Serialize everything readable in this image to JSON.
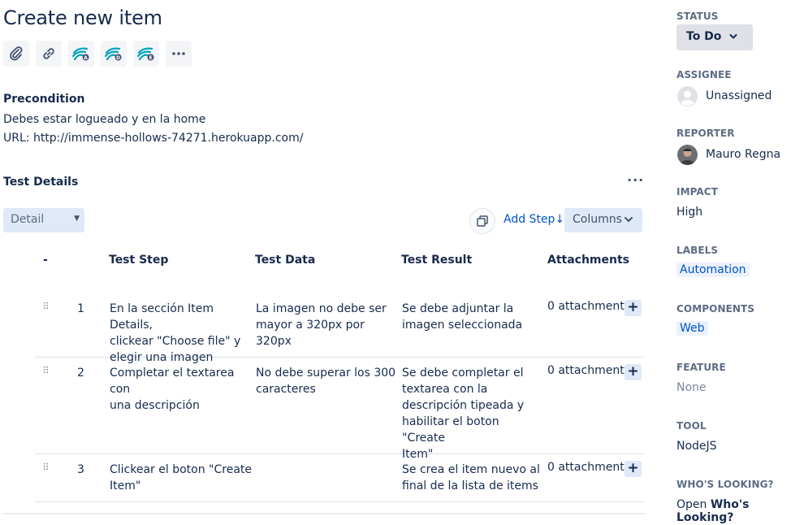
{
  "page_title": "Create new item",
  "precondition": {
    "heading": "Precondition",
    "line1": "Debes estar logueado y en la home",
    "line2": "URL: http://immense-hollows-74271.herokuapp.com/"
  },
  "test_details": {
    "heading": "Test Details",
    "more": "···",
    "view_select": "Detail",
    "add_step": "Add Step↓",
    "columns": "Columns",
    "headers": {
      "order": "-",
      "step": "Test Step",
      "data": "Test Data",
      "result": "Test Result",
      "attachments": "Attachments"
    },
    "rows": [
      {
        "num": "1",
        "step": [
          "En la sección Item Details,",
          "clickear \"Choose file\" y",
          "elegir una imagen"
        ],
        "data": [
          "La imagen no debe ser",
          "mayor a 320px por 320px"
        ],
        "result": [
          "Se debe adjuntar la",
          "imagen seleccionada"
        ],
        "attachments": "0 attachments"
      },
      {
        "num": "2",
        "step": [
          "Completar el textarea con",
          "una descripción"
        ],
        "data": [
          "No debe superar los 300",
          "caracteres"
        ],
        "result": [
          "Se debe completar el",
          "textarea con la",
          "descripción tipeada y",
          "habilitar el boton \"Create",
          "Item\""
        ],
        "attachments": "0 attachments"
      },
      {
        "num": "3",
        "step": [
          "Clickear el boton \"Create",
          "Item\""
        ],
        "data": [],
        "result": [
          "Se crea el item nuevo al",
          "final de la lista de items"
        ],
        "attachments": "0 attachments"
      }
    ]
  },
  "sidebar": {
    "status": {
      "label": "STATUS",
      "value": "To Do"
    },
    "assignee": {
      "label": "ASSIGNEE",
      "value": "Unassigned"
    },
    "reporter": {
      "label": "REPORTER",
      "value": "Mauro Regna"
    },
    "impact": {
      "label": "IMPACT",
      "value": "High"
    },
    "labels": {
      "label": "LABELS",
      "value": "Automation"
    },
    "components": {
      "label": "COMPONENTS",
      "value": "Web"
    },
    "feature": {
      "label": "FEATURE",
      "value": "None"
    },
    "tool": {
      "label": "TOOL",
      "value": "NodeJS"
    },
    "whos_looking": {
      "label": "WHO'S LOOKING?",
      "prefix": "Open",
      "link": "Who's Looking?"
    }
  },
  "colors": {
    "link": "#0052cc",
    "text": "#172b4d",
    "muted": "#5e6c84",
    "button_bg": "#dfe9f7",
    "icon_teal": "#00a3bf"
  },
  "toolbar_icons": [
    "paperclip-icon",
    "link-icon",
    "xray-a-icon",
    "xray-d-icon",
    "xray-e-icon",
    "more-icon"
  ]
}
